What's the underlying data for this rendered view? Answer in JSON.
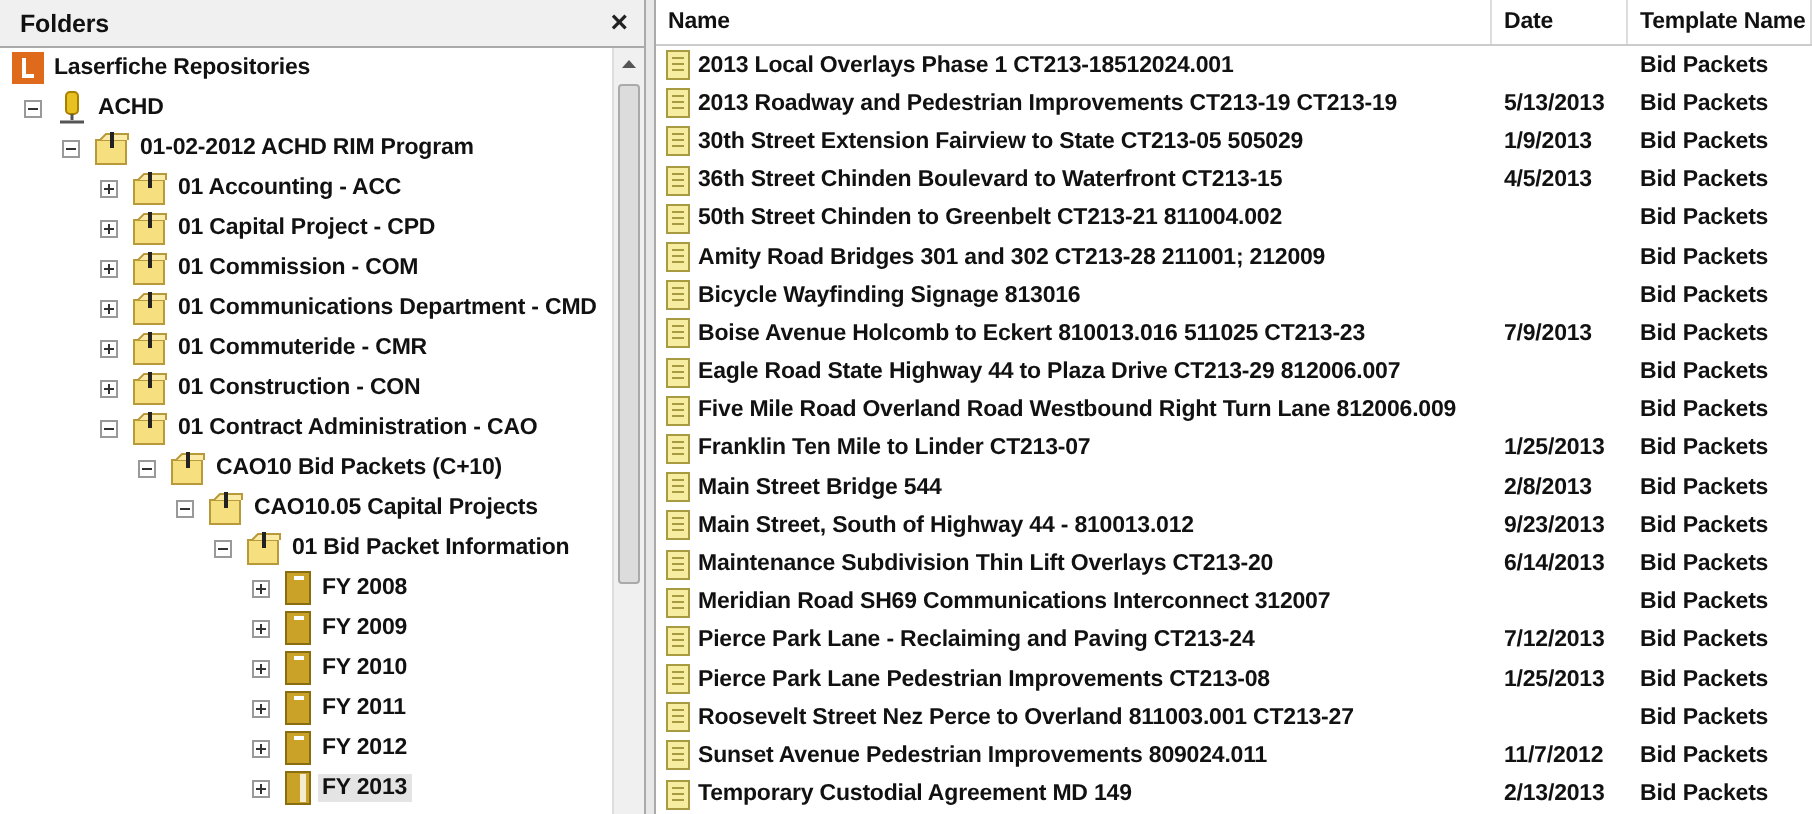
{
  "folders_panel": {
    "title": "Folders",
    "close": "×",
    "tree": [
      {
        "label": "Laserfiche Repositories",
        "kind": "repository",
        "selected": false,
        "children": [
          {
            "label": "ACHD",
            "kind": "server",
            "expanded": true,
            "selected": false,
            "children": [
              {
                "label": "01-02-2012 ACHD RIM Program",
                "kind": "cabinet",
                "expanded": true,
                "selected": false,
                "children": [
                  {
                    "label": "01 Accounting - ACC",
                    "kind": "cabinet",
                    "expanded": false,
                    "selected": false
                  },
                  {
                    "label": "01 Capital Project - CPD",
                    "kind": "cabinet",
                    "expanded": false,
                    "selected": false
                  },
                  {
                    "label": "01 Commission - COM",
                    "kind": "cabinet",
                    "expanded": false,
                    "selected": false
                  },
                  {
                    "label": "01 Communications Department - CMD",
                    "kind": "cabinet",
                    "expanded": false,
                    "selected": false
                  },
                  {
                    "label": "01 Commuteride - CMR",
                    "kind": "cabinet",
                    "expanded": false,
                    "selected": false
                  },
                  {
                    "label": "01 Construction - CON",
                    "kind": "cabinet",
                    "expanded": false,
                    "selected": false
                  },
                  {
                    "label": "01 Contract Administration - CAO",
                    "kind": "cabinet",
                    "expanded": true,
                    "selected": false,
                    "children": [
                      {
                        "label": "CAO10 Bid Packets (C+10)",
                        "kind": "cabinet",
                        "expanded": true,
                        "selected": false,
                        "children": [
                          {
                            "label": "CAO10.05 Capital Projects",
                            "kind": "cabinet",
                            "expanded": true,
                            "selected": false,
                            "children": [
                              {
                                "label": "01 Bid Packet Information",
                                "kind": "cabinet",
                                "expanded": true,
                                "selected": false,
                                "children": [
                                  {
                                    "label": "FY 2008",
                                    "kind": "folder",
                                    "expanded": false,
                                    "selected": false
                                  },
                                  {
                                    "label": "FY 2009",
                                    "kind": "folder",
                                    "expanded": false,
                                    "selected": false
                                  },
                                  {
                                    "label": "FY 2010",
                                    "kind": "folder",
                                    "expanded": false,
                                    "selected": false
                                  },
                                  {
                                    "label": "FY 2011",
                                    "kind": "folder",
                                    "expanded": false,
                                    "selected": false
                                  },
                                  {
                                    "label": "FY 2012",
                                    "kind": "folder",
                                    "expanded": false,
                                    "selected": false
                                  },
                                  {
                                    "label": "FY 2013",
                                    "kind": "folder-open",
                                    "expanded": false,
                                    "selected": true
                                  }
                                ]
                              }
                            ]
                          }
                        ]
                      }
                    ]
                  }
                ]
              }
            ]
          }
        ]
      }
    ]
  },
  "documents": {
    "columns": [
      "Name",
      "Date",
      "Template Name"
    ],
    "rows": [
      {
        "name": "2013 Local Overlays Phase 1 CT213-18512024.001",
        "template": "Bid Packets"
      },
      {
        "name": "2013 Roadway and Pedestrian Improvements  CT213-19 CT213-19",
        "date": "5/13/2013",
        "template": "Bid Packets"
      },
      {
        "name": "30th Street Extension Fairview to State CT213-05 505029",
        "date": "1/9/2013",
        "template": "Bid Packets"
      },
      {
        "name": "36th Street Chinden Boulevard to Waterfront  CT213-15",
        "date": "4/5/2013",
        "template": "Bid Packets"
      },
      {
        "name": "50th Street Chinden to Greenbelt CT213-21 811004.002",
        "template": "Bid Packets"
      },
      {
        "name": "Amity Road Bridges 301 and 302 CT213-28 211001; 212009",
        "template": "Bid Packets"
      },
      {
        "name": "Bicycle Wayfinding Signage 813016",
        "template": "Bid Packets"
      },
      {
        "name": "Boise Avenue Holcomb to Eckert  810013.016  511025 CT213-23",
        "date": "7/9/2013",
        "template": "Bid Packets"
      },
      {
        "name": "Eagle Road State Highway 44 to Plaza Drive  CT213-29 812006.007",
        "template": "Bid Packets"
      },
      {
        "name": "Five Mile Road Overland Road Westbound Right Turn Lane 812006.009",
        "template": "Bid Packets"
      },
      {
        "name": "Franklin Ten Mile to Linder CT213-07",
        "date": "1/25/2013",
        "template": "Bid Packets"
      },
      {
        "name": "Main Street Bridge 544",
        "date": "2/8/2013",
        "template": "Bid Packets"
      },
      {
        "name": "Main Street, South of Highway 44 - 810013.012",
        "date": "9/23/2013",
        "template": "Bid Packets"
      },
      {
        "name": "Maintenance Subdivision Thin Lift Overlays CT213-20",
        "date": "6/14/2013",
        "template": "Bid Packets"
      },
      {
        "name": "Meridian Road SH69 Communications Interconnect 312007",
        "template": "Bid Packets"
      },
      {
        "name": "Pierce Park Lane - Reclaiming and Paving  CT213-24",
        "date": "7/12/2013",
        "template": "Bid Packets"
      },
      {
        "name": "Pierce Park Lane Pedestrian Improvements CT213-08",
        "date": "1/25/2013",
        "template": "Bid Packets"
      },
      {
        "name": "Roosevelt Street Nez Perce to Overland 811003.001 CT213-27",
        "template": "Bid Packets"
      },
      {
        "name": "Sunset Avenue Pedestrian Improvements 809024.011",
        "date": "11/7/2012",
        "template": "Bid Packets"
      },
      {
        "name": "Temporary Custodial Agreement MD 149",
        "date": "2/13/2013",
        "template": "Bid Packets"
      }
    ]
  }
}
